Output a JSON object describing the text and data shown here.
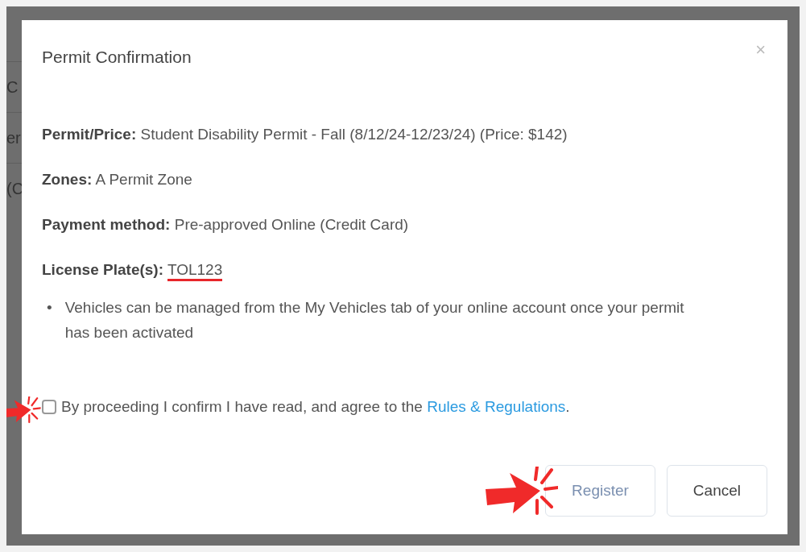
{
  "background_page": {
    "fragments": [
      "C",
      "er",
      "(C"
    ]
  },
  "dialog": {
    "title": "Permit Confirmation",
    "close": "×",
    "details": [
      {
        "label": "Permit/Price:",
        "value": "Student Disability Permit - Fall (8/12/24-12/23/24) (Price: $142)",
        "highlighted": false
      },
      {
        "label": "Zones:",
        "value": "A Permit Zone",
        "highlighted": false
      },
      {
        "label": "Payment method:",
        "value": "Pre-approved Online (Credit Card)",
        "highlighted": false
      },
      {
        "label": "License Plate(s):",
        "value": "TOL123",
        "highlighted": true
      }
    ],
    "bullet": "•",
    "notes": [
      "Vehicles can be managed from the My Vehicles tab of your online account once your permit has been activated"
    ],
    "agreement": {
      "checked": false,
      "text": "By proceeding I confirm I have read, and agree to the",
      "link": "Rules & Regulations",
      "end": ".",
      "pointed": true
    },
    "buttons": [
      {
        "label": "Register",
        "disabled": true,
        "pointed": true
      },
      {
        "label": "Cancel",
        "disabled": false,
        "pointed": false
      }
    ]
  }
}
